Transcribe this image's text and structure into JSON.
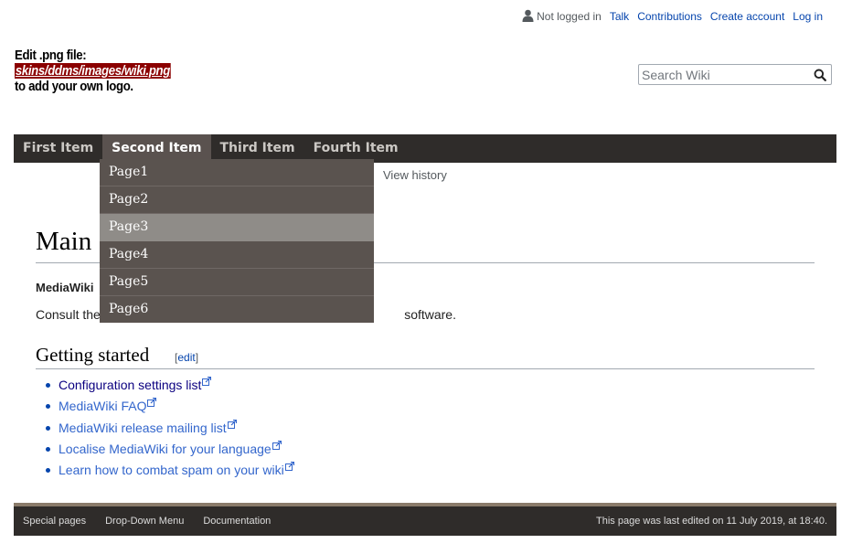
{
  "personal": {
    "status": "Not logged in",
    "talk": "Talk",
    "contributions": "Contributions",
    "create_account": "Create account",
    "login": "Log in"
  },
  "logo": {
    "line1": "Edit .png file:",
    "line2": "skins/ddms/images/wiki.png",
    "line3": "to add your own logo."
  },
  "search": {
    "placeholder": "Search Wiki"
  },
  "navbar": {
    "items": [
      {
        "label": "First Item"
      },
      {
        "label": "Second Item"
      },
      {
        "label": "Third Item"
      },
      {
        "label": "Fourth Item"
      }
    ],
    "active": "Second Item"
  },
  "dropdown": {
    "items": [
      {
        "label": "Page1"
      },
      {
        "label": "Page2"
      },
      {
        "label": "Page3"
      },
      {
        "label": "Page4"
      },
      {
        "label": "Page5"
      },
      {
        "label": "Page6"
      }
    ],
    "highlighted": "Page3"
  },
  "view_history": "View history",
  "content": {
    "title": "Main",
    "mediawiki_line": "MediaWiki",
    "consult_start": "Consult the",
    "consult_end": "software.",
    "section_heading": "Getting started",
    "edit_open": "[",
    "edit_label": "edit",
    "edit_close": "]",
    "links": [
      {
        "label": "Configuration settings list",
        "color": "#0b0080"
      },
      {
        "label": "MediaWiki FAQ",
        "color": "#3366cc"
      },
      {
        "label": "MediaWiki release mailing list",
        "color": "#3366cc"
      },
      {
        "label": "Localise MediaWiki for your language",
        "color": "#3366cc"
      },
      {
        "label": "Learn how to combat spam on your wiki",
        "color": "#3366cc"
      }
    ]
  },
  "footer": {
    "links": [
      {
        "label": "Special pages"
      },
      {
        "label": "Drop-Down Menu"
      },
      {
        "label": "Documentation"
      }
    ],
    "last_modified": "This page was last edited on 11 July 2019, at 18:40."
  },
  "colors": {
    "nav_bg": "#2f2c2a",
    "nav_active": "#5a524f",
    "dropdown_bg": "#5a534f",
    "dropdown_highlight": "#8f8c88",
    "link": "#3366cc",
    "visited_link": "#0b0080"
  }
}
